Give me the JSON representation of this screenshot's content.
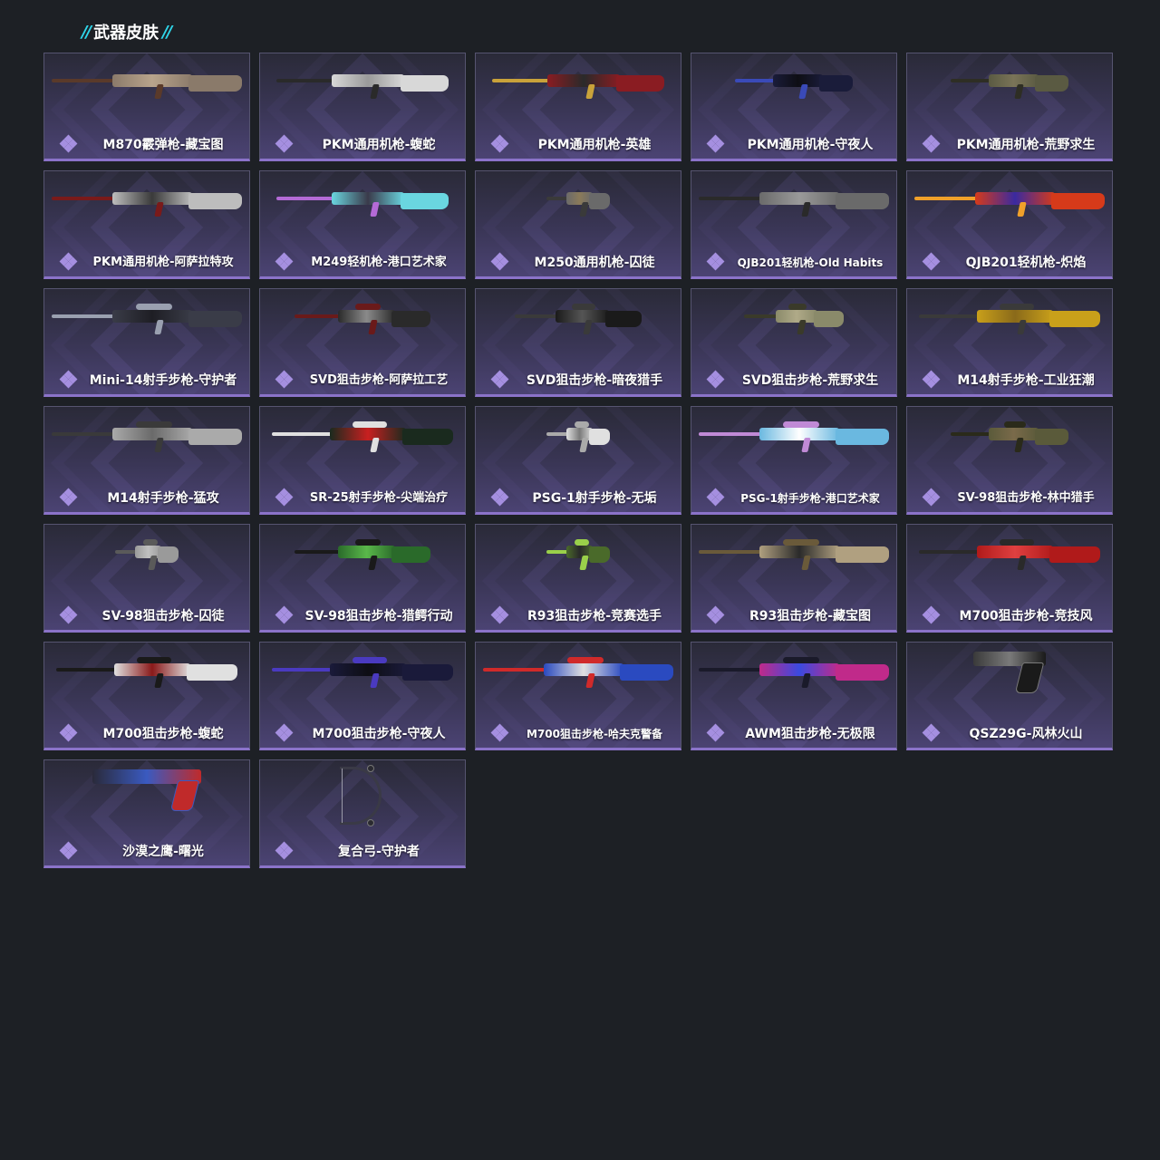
{
  "section": {
    "title": "武器皮肤",
    "accent_color": "#2fd6ea"
  },
  "rarity_color": "#8b73c9",
  "skins": [
    {
      "name": "M870霰弹枪-藏宝图",
      "icon": "shotgun-icon",
      "colors": [
        "#8a7a6a",
        "#5a3a2a",
        "#b9a48c"
      ]
    },
    {
      "name": "PKM通用机枪-蝮蛇",
      "icon": "machine-gun-icon",
      "colors": [
        "#d8d8d8",
        "#2a2a2a",
        "#9a9a9a"
      ]
    },
    {
      "name": "PKM通用机枪-英雄",
      "icon": "machine-gun-icon",
      "colors": [
        "#8a1c22",
        "#c9a23a",
        "#2a2a2a"
      ]
    },
    {
      "name": "PKM通用机枪-守夜人",
      "icon": "machine-gun-icon",
      "colors": [
        "#1a1c3a",
        "#3a4ab8",
        "#0e0e14"
      ]
    },
    {
      "name": "PKM通用机枪-荒野求生",
      "icon": "machine-gun-icon",
      "colors": [
        "#5a5a42",
        "#2e2e24",
        "#7a7458"
      ]
    },
    {
      "name": "PKM通用机枪-阿萨拉特攻",
      "icon": "machine-gun-icon",
      "colors": [
        "#bdbdbd",
        "#7a1a1a",
        "#3a3a3a"
      ]
    },
    {
      "name": "M249轻机枪-港口艺术家",
      "icon": "machine-gun-icon",
      "colors": [
        "#6ad6e0",
        "#b46ad6",
        "#3a3a4a"
      ]
    },
    {
      "name": "M250通用机枪-囚徒",
      "icon": "machine-gun-icon",
      "colors": [
        "#6a6a6a",
        "#3a3a3a",
        "#8a7a5a"
      ]
    },
    {
      "name": "QJB201轻机枪-Old Habits",
      "icon": "machine-gun-icon",
      "colors": [
        "#6a6a6a",
        "#2a2a2a",
        "#9a9a9a"
      ]
    },
    {
      "name": "QJB201轻机枪-炽焰",
      "icon": "machine-gun-icon",
      "colors": [
        "#d63a1a",
        "#f0a02a",
        "#3a2aa0"
      ]
    },
    {
      "name": "Mini-14射手步枪-守护者",
      "icon": "rifle-icon",
      "colors": [
        "#3a3c48",
        "#9aa0b0",
        "#1e1e24"
      ]
    },
    {
      "name": "SVD狙击步枪-阿萨拉工艺",
      "icon": "sniper-rifle-icon",
      "colors": [
        "#2a2a2a",
        "#6a1a1a",
        "#8a8a8a"
      ]
    },
    {
      "name": "SVD狙击步枪-暗夜猎手",
      "icon": "sniper-rifle-icon",
      "colors": [
        "#1a1a1a",
        "#3a3a3a",
        "#555555"
      ]
    },
    {
      "name": "SVD狙击步枪-荒野求生",
      "icon": "sniper-rifle-icon",
      "colors": [
        "#8a8a6a",
        "#3a3a2a",
        "#b0aa88"
      ]
    },
    {
      "name": "M14射手步枪-工业狂潮",
      "icon": "rifle-icon",
      "colors": [
        "#c9a01a",
        "#3a3a3a",
        "#8a6a1a"
      ]
    },
    {
      "name": "M14射手步枪-猛攻",
      "icon": "rifle-icon",
      "colors": [
        "#aaaaaa",
        "#3a3a3a",
        "#6a6a6a"
      ]
    },
    {
      "name": "SR-25射手步枪-尖端治疗",
      "icon": "rifle-icon",
      "colors": [
        "#1a2a1e",
        "#e0e0e0",
        "#c82020"
      ]
    },
    {
      "name": "PSG-1射手步枪-无垢",
      "icon": "sniper-rifle-icon",
      "colors": [
        "#e0e0e0",
        "#aaaaaa",
        "#7a7a7a"
      ]
    },
    {
      "name": "PSG-1射手步枪-港口艺术家",
      "icon": "sniper-rifle-icon",
      "colors": [
        "#6ab8e0",
        "#c08ad6",
        "#ffffff"
      ]
    },
    {
      "name": "SV-98狙击步枪-林中猎手",
      "icon": "sniper-rifle-icon",
      "colors": [
        "#5a5a3a",
        "#2a2a1a",
        "#7a6a4a"
      ]
    },
    {
      "name": "SV-98狙击步枪-囚徒",
      "icon": "sniper-rifle-icon",
      "colors": [
        "#9a9a9a",
        "#5a5a5a",
        "#c0c0c0"
      ]
    },
    {
      "name": "SV-98狙击步枪-猎鳄行动",
      "icon": "sniper-rifle-icon",
      "colors": [
        "#2a6a2a",
        "#1a1a1a",
        "#5ab84a"
      ]
    },
    {
      "name": "R93狙击步枪-竞赛选手",
      "icon": "sniper-rifle-icon",
      "colors": [
        "#4a6a2a",
        "#9ad04a",
        "#2a2a2a"
      ]
    },
    {
      "name": "R93狙击步枪-藏宝图",
      "icon": "sniper-rifle-icon",
      "colors": [
        "#b0a080",
        "#6a5a3a",
        "#2a2a2a"
      ]
    },
    {
      "name": "M700狙击步枪-竞技风",
      "icon": "sniper-rifle-icon",
      "colors": [
        "#b01a1a",
        "#2a2a2a",
        "#e04040"
      ]
    },
    {
      "name": "M700狙击步枪-蝮蛇",
      "icon": "sniper-rifle-icon",
      "colors": [
        "#e0e0e0",
        "#1a1a1a",
        "#8a1a1a"
      ]
    },
    {
      "name": "M700狙击步枪-守夜人",
      "icon": "sniper-rifle-icon",
      "colors": [
        "#1a1a3a",
        "#4a3ac0",
        "#0e0e14"
      ]
    },
    {
      "name": "M700狙击步枪-哈夫克警备",
      "icon": "sniper-rifle-icon",
      "colors": [
        "#2a4ac0",
        "#d02a2a",
        "#e0e0e0"
      ]
    },
    {
      "name": "AWM狙击步枪-无极限",
      "icon": "sniper-rifle-icon",
      "colors": [
        "#c02a8a",
        "#1a1a2a",
        "#3a4ae0"
      ]
    },
    {
      "name": "QSZ29G-风林火山",
      "icon": "pistol-icon",
      "colors": [
        "#3a3a3a",
        "#1a1a1a",
        "#7a7a7a"
      ]
    },
    {
      "name": "沙漠之鹰-曙光",
      "icon": "pistol-icon",
      "colors": [
        "#2a2a3a",
        "#c02a2a",
        "#3a5ac0"
      ]
    },
    {
      "name": "复合弓-守护者",
      "icon": "bow-icon",
      "colors": [
        "#3a3a46",
        "#9a9aa8",
        "#2a2a30"
      ]
    }
  ]
}
